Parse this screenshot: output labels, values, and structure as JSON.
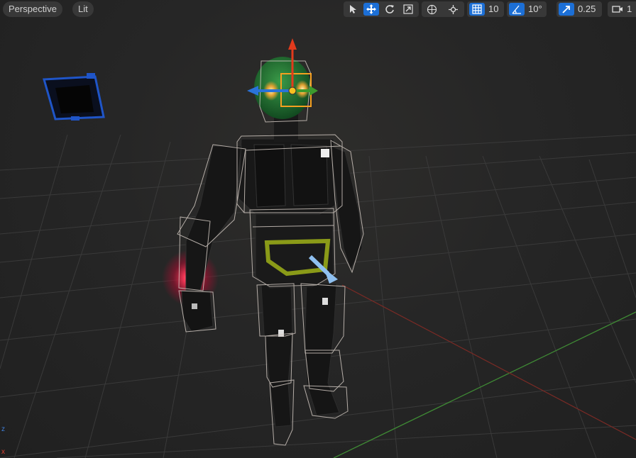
{
  "viewport": {
    "view_mode_label": "Perspective",
    "lighting_mode_label": "Lit"
  },
  "toolbar": {
    "tools": [
      {
        "icon": "select-arrow-icon",
        "active": false
      },
      {
        "icon": "translate-icon",
        "active": true
      },
      {
        "icon": "rotate-icon",
        "active": false
      },
      {
        "icon": "scale-icon",
        "active": false
      }
    ],
    "grid_snap_value": "10",
    "rotation_snap_value": "10°",
    "scale_snap_value": "0.25",
    "camera_speed_value": "1"
  },
  "axis_indicator": {
    "z_label": "z",
    "x_label": "x"
  },
  "colors": {
    "accent": "#1c6fd6",
    "selection_box": "#cfc6bf",
    "selected_bone": "#f5a020",
    "gizmo_x": "#e23a1c",
    "gizmo_y": "#3c9a2e",
    "gizmo_z": "#2a73d8",
    "glow": "#ff3050"
  }
}
